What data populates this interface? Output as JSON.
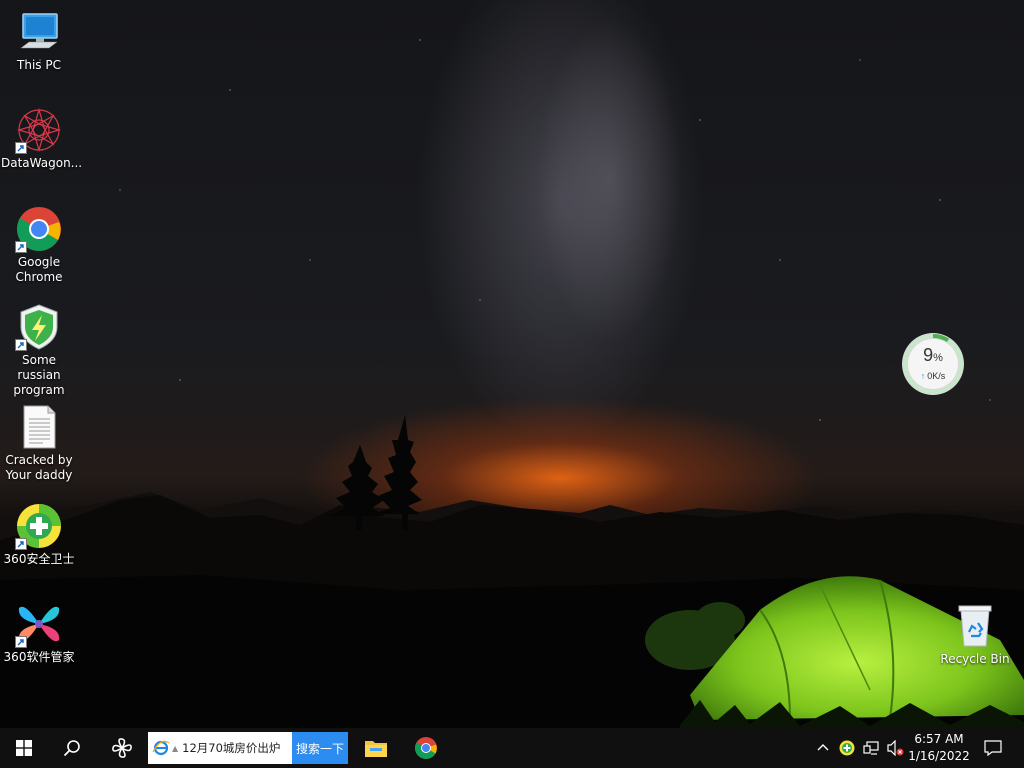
{
  "desktop": {
    "icons": [
      {
        "label": "This PC",
        "icon": "computer-icon"
      },
      {
        "label": "DataWagon...",
        "icon": "datawagon-icon"
      },
      {
        "label_line1": "Google",
        "label_line2": "Chrome",
        "icon": "chrome-icon"
      },
      {
        "label_line1": "Some russian",
        "label_line2": "program",
        "icon": "shield-bolt-icon"
      },
      {
        "label_line1": "Cracked by",
        "label_line2": "Your daddy",
        "icon": "text-document-icon"
      },
      {
        "label": "360安全卫士",
        "icon": "360-security-icon"
      },
      {
        "label": "360软件管家",
        "icon": "360-software-manager-icon"
      },
      {
        "label": "Recycle Bin",
        "icon": "recycle-bin-icon"
      }
    ]
  },
  "net_meter": {
    "percent": "9",
    "percent_unit": "%",
    "percent_value": 9,
    "speed": "0K/s"
  },
  "taskbar": {
    "search_text": "12月70城房价出炉",
    "search_button": "搜索一下",
    "icons": [
      "windows-start-icon",
      "search-icon",
      "pinwheel-icon",
      "ie-icon",
      "file-explorer-icon",
      "chrome-icon"
    ]
  },
  "tray": {
    "icons": [
      "chevron-up-icon",
      "360-tray-icon",
      "network-icon",
      "volume-muted-icon",
      "action-center-icon"
    ],
    "time": "6:57 AM",
    "date": "1/16/2022"
  },
  "colors": {
    "taskbar": "#101010",
    "search_button": "#2d8cf0",
    "tent_green": "#8fd62a",
    "glow_orange": "#ff6e14"
  }
}
